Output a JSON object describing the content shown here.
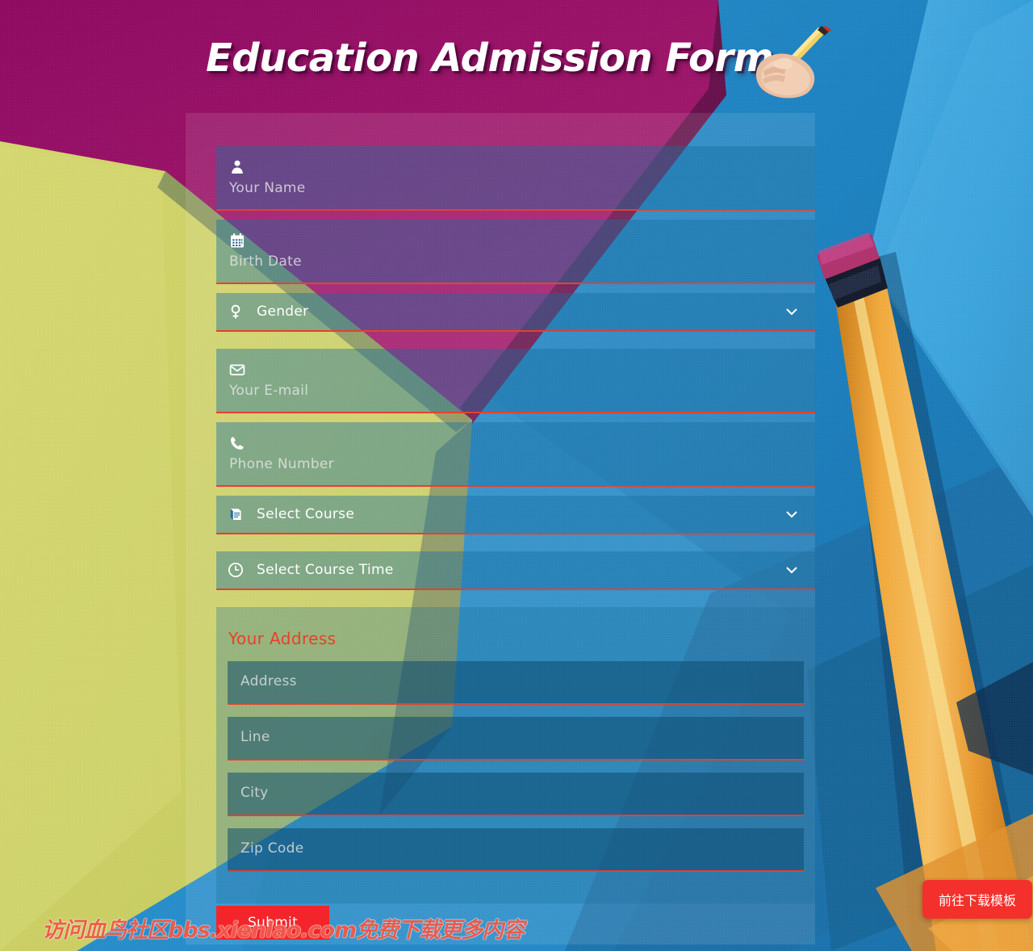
{
  "header": {
    "title": "Education Admission Form",
    "hand_pencil_icon": "hand-writing-pencil-icon"
  },
  "colors": {
    "accent_red": "#e8402a",
    "submit_red": "#f4252a",
    "field_blue": "#2079ad",
    "address_panel_blue": "#1b5c80",
    "page_blue": "#1f86c4",
    "banner_magenta": "#8d0a62",
    "paper_yellow": "#ccd064"
  },
  "form": {
    "fields": [
      {
        "name": "your-name",
        "icon": "user-icon",
        "placeholder": "Your Name"
      },
      {
        "name": "birth-date",
        "icon": "calendar-icon",
        "placeholder": "Birth Date"
      }
    ],
    "gender_select": {
      "name": "gender",
      "icon": "venus-gender-icon",
      "label": "Gender",
      "chevron": "chevron-down-icon"
    },
    "contact_fields": [
      {
        "name": "your-email",
        "icon": "envelope-icon",
        "placeholder": "Your E-mail"
      },
      {
        "name": "phone-number",
        "icon": "phone-icon",
        "placeholder": "Phone Number"
      }
    ],
    "course_select": {
      "name": "select-course",
      "icon": "book-icon",
      "label": "Select Course",
      "chevron": "chevron-down-icon"
    },
    "course_time_select": {
      "name": "select-course-time",
      "icon": "clock-icon",
      "label": "Select Course Time",
      "chevron": "chevron-down-icon"
    },
    "address": {
      "title": "Your Address",
      "fields": [
        {
          "name": "address",
          "placeholder": "Address"
        },
        {
          "name": "line",
          "placeholder": "Line"
        },
        {
          "name": "city",
          "placeholder": "City"
        },
        {
          "name": "zip-code",
          "placeholder": "Zip Code"
        }
      ]
    },
    "submit_label": "Submit"
  },
  "overlay": {
    "watermark_text": "访问血鸟社区bbs.xienlao.com免费下载更多内容",
    "download_button_label": "前往下载模板"
  }
}
